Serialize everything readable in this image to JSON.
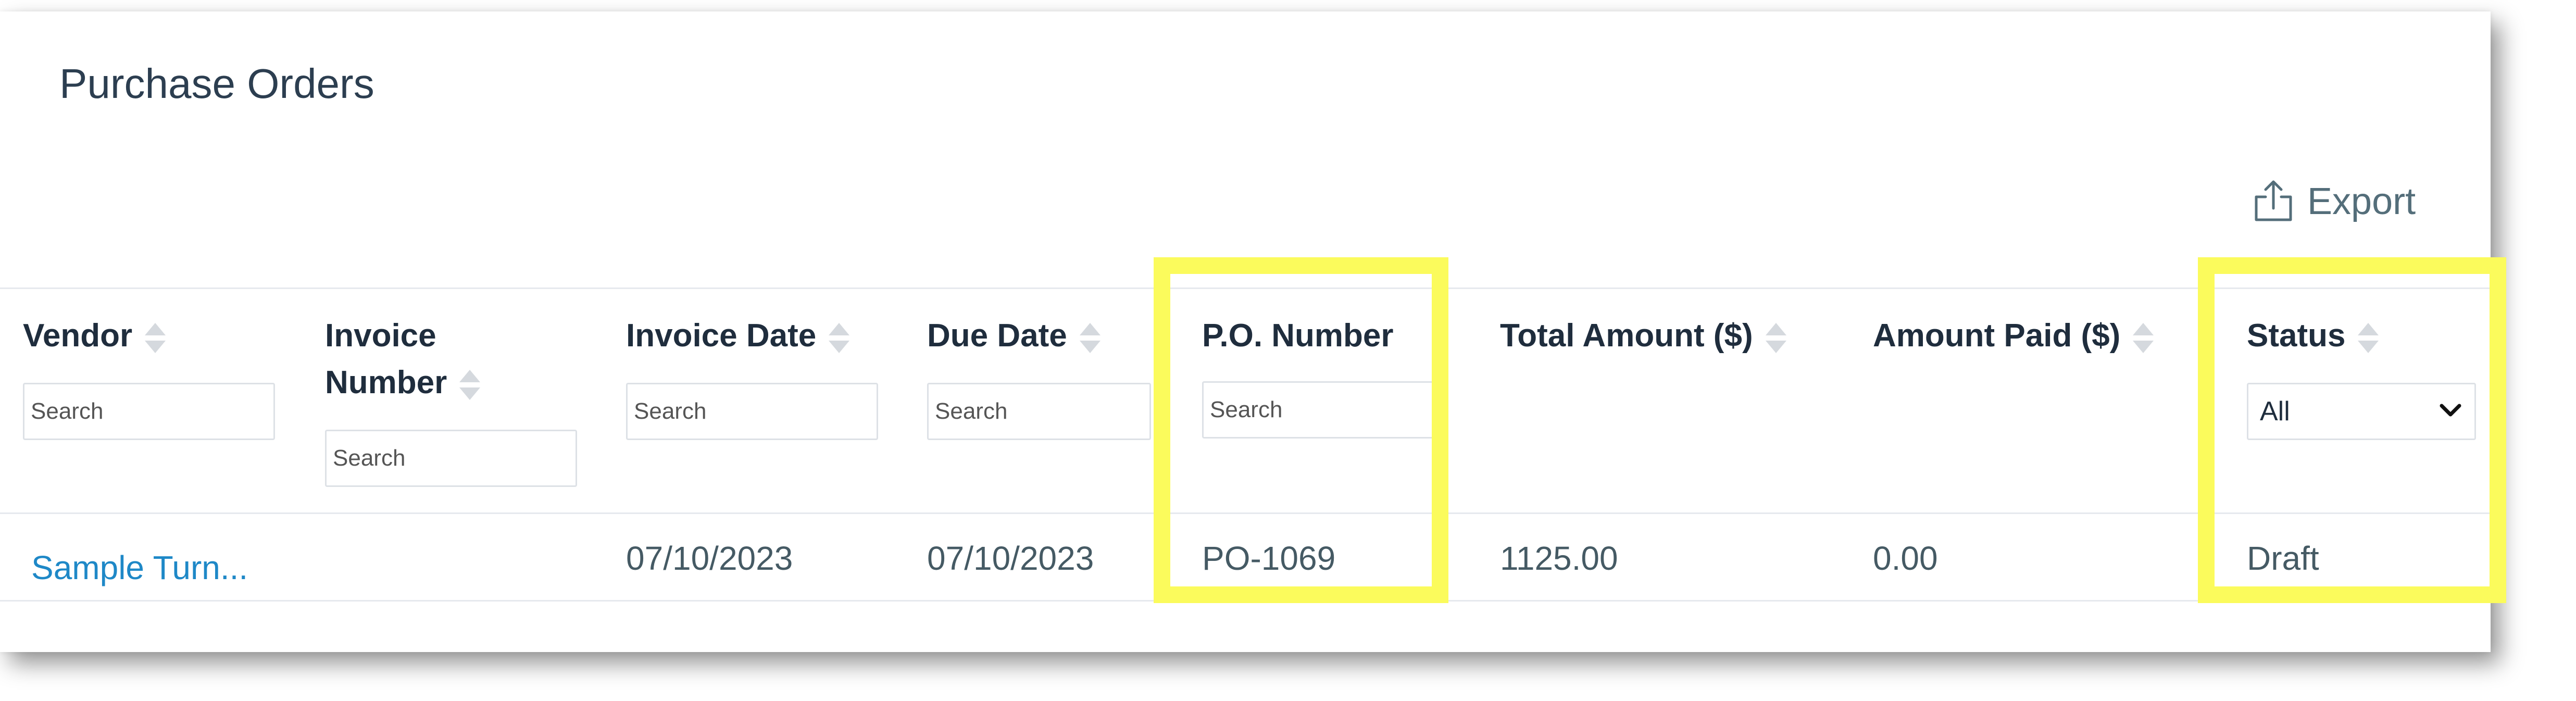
{
  "page": {
    "title": "Purchase Orders",
    "export_label": "Export",
    "export_icon": "share-export-icon"
  },
  "table": {
    "columns": [
      {
        "key": "vendor",
        "label": "Vendor",
        "sortable": true,
        "filter": "text",
        "placeholder": "Search"
      },
      {
        "key": "invoice_number",
        "label_lines": [
          "Invoice",
          "Number"
        ],
        "sortable": true,
        "filter": "text",
        "placeholder": "Search"
      },
      {
        "key": "invoice_date",
        "label": "Invoice Date",
        "sortable": true,
        "filter": "text",
        "placeholder": "Search"
      },
      {
        "key": "due_date",
        "label": "Due Date",
        "sortable": true,
        "filter": "text",
        "placeholder": "Search"
      },
      {
        "key": "po_number",
        "label": "P.O. Number",
        "sortable": false,
        "filter": "text",
        "placeholder": "Search"
      },
      {
        "key": "total_amount",
        "label": "Total Amount ($)",
        "sortable": true
      },
      {
        "key": "amount_paid",
        "label": "Amount Paid ($)",
        "sortable": true
      },
      {
        "key": "status",
        "label": "Status",
        "sortable": true,
        "filter": "select",
        "selected": "All"
      }
    ],
    "rows": [
      {
        "vendor": "Sample Turn...",
        "invoice_number": "",
        "invoice_date": "07/10/2023",
        "due_date": "07/10/2023",
        "po_number": "PO-1069",
        "total_amount": "1125.00",
        "amount_paid": "0.00",
        "status": "Draft"
      }
    ]
  },
  "highlights": [
    "po_number",
    "status"
  ],
  "colors": {
    "highlight": "#fbfb5c",
    "link": "#1e88c7",
    "header_text": "#1f2d3d",
    "body_text": "#455a64",
    "title_text": "#2c3e50"
  }
}
